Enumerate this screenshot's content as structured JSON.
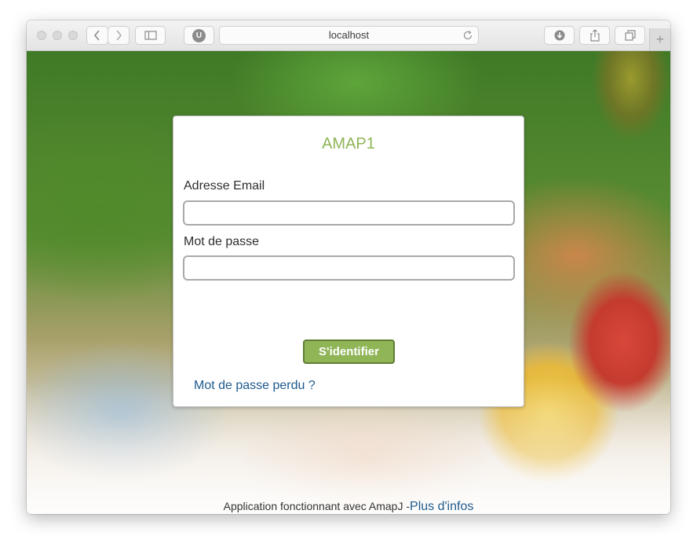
{
  "browser": {
    "url": "localhost",
    "extension_badge": "U",
    "new_tab_label": "+"
  },
  "login": {
    "title": "AMAP1",
    "email_label": "Adresse Email",
    "email_value": "",
    "password_label": "Mot de passe",
    "password_value": "",
    "submit_label": "S'identifier",
    "forgot_link": "Mot de passe perdu ?"
  },
  "footer": {
    "text": "Application fonctionnant avec AmapJ -",
    "link": "Plus d'infos"
  },
  "colors": {
    "accent": "#8fb557",
    "link": "#1f5a8e"
  },
  "icons": [
    "back-icon",
    "forward-icon",
    "sidebar-icon",
    "reload-icon",
    "download-icon",
    "share-icon",
    "tabs-icon"
  ]
}
